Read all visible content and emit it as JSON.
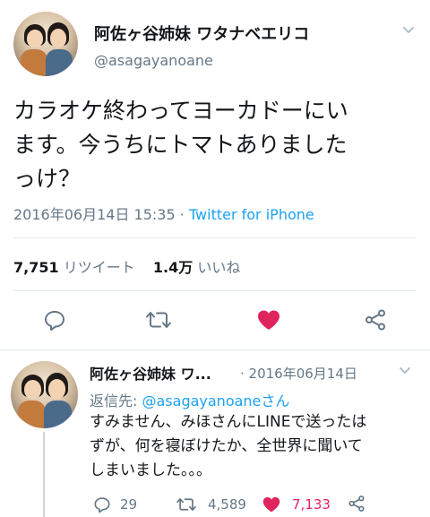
{
  "tweet": {
    "display_name": "阿佐ヶ谷姉妹 ワタナベエリコ",
    "handle": "@asagayanoane",
    "text_lines": [
      "カラオケ終わってヨーカドーにい",
      "ます。今うちにトマトありました",
      "っけ？"
    ],
    "date": "2016年06月14日 15:35",
    "separator": "·",
    "source": "Twitter for iPhone",
    "retweets_count": "7,751",
    "retweets_label": "リツイート",
    "likes_count": "1.4万",
    "likes_label": "いいね"
  },
  "actions": [
    "reply-icon",
    "retweet-icon",
    "like-icon",
    "share-icon"
  ],
  "reply": {
    "display_name": "阿佐ヶ谷姉妹 ワ...",
    "date": "· 2016年06月14日",
    "reply_to_prefix": "返信先:",
    "reply_to_handle": "@asagayanoane",
    "reply_to_suffix": "さん",
    "text_lines": [
      "すみません、みほさんにLINEで送ったは",
      "ずが、何を寝ぼけたか、全世界に聞いて",
      "しまいました。。。"
    ],
    "replies_count": "29",
    "retweets_count": "4,589",
    "likes_count": "7,133"
  },
  "colors": {
    "accent": "#1da1f2",
    "like": "#e0245e",
    "muted": "#657786",
    "divider": "#e1e8ed"
  }
}
